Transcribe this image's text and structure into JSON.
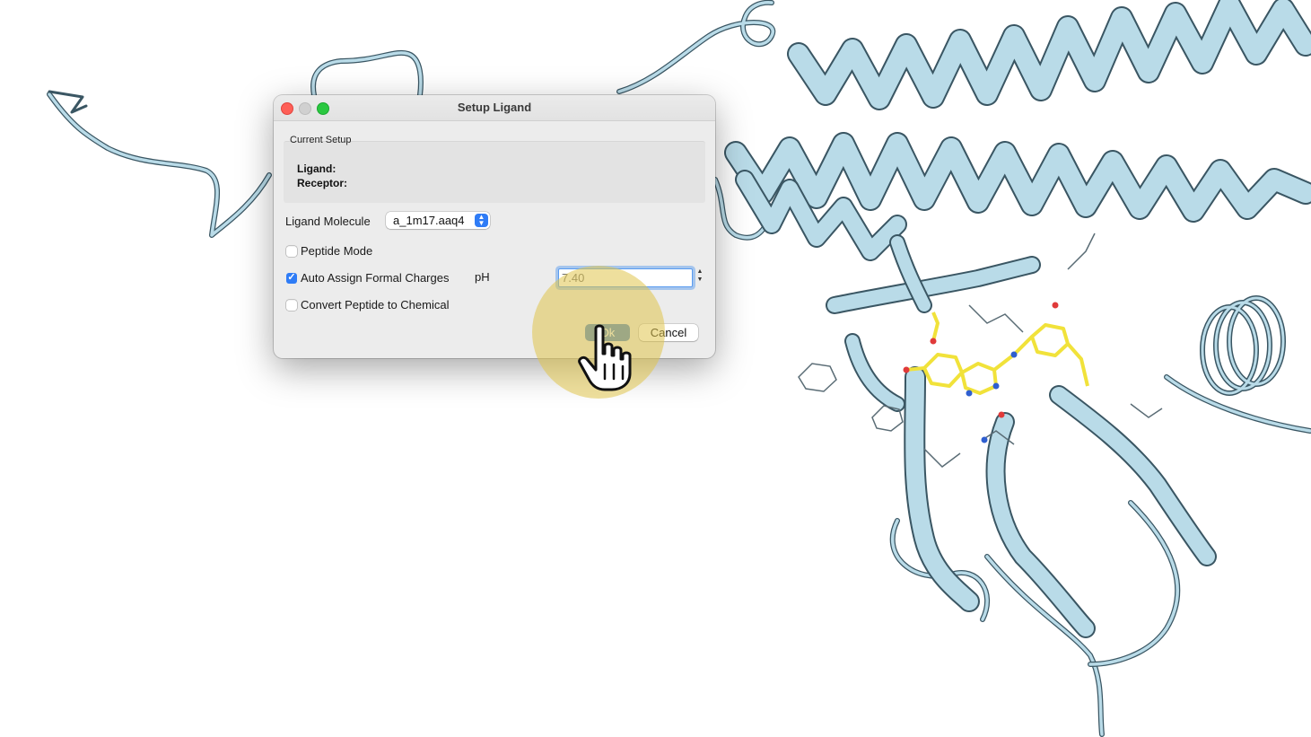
{
  "dialog": {
    "title": "Setup Ligand",
    "current_setup": {
      "group_label": "Current Setup",
      "ligand_label": "Ligand:",
      "receptor_label": "Receptor:"
    },
    "ligand_molecule": {
      "label": "Ligand Molecule",
      "value": "a_1m17.aaq4"
    },
    "peptide_mode": {
      "label": "Peptide Mode",
      "checked": false
    },
    "auto_assign": {
      "label": "Auto Assign Formal Charges",
      "checked": true
    },
    "ph": {
      "label": "pH",
      "value": "7.40"
    },
    "convert_peptide": {
      "label": "Convert Peptide to Chemical",
      "checked": false
    },
    "buttons": {
      "ok": "Ok",
      "cancel": "Cancel"
    }
  },
  "colors": {
    "ribbon": "#b9dbe8",
    "ribbon_edge": "#3a5663",
    "ligand": "#f1e23a",
    "accent": "#2f7cf6",
    "cursor_highlight": "#e0c44c"
  },
  "icons": {
    "cursor": "hand-pointer-icon",
    "popup_arrows": "chevron-up-down-icon",
    "check": "checkmark-icon"
  }
}
